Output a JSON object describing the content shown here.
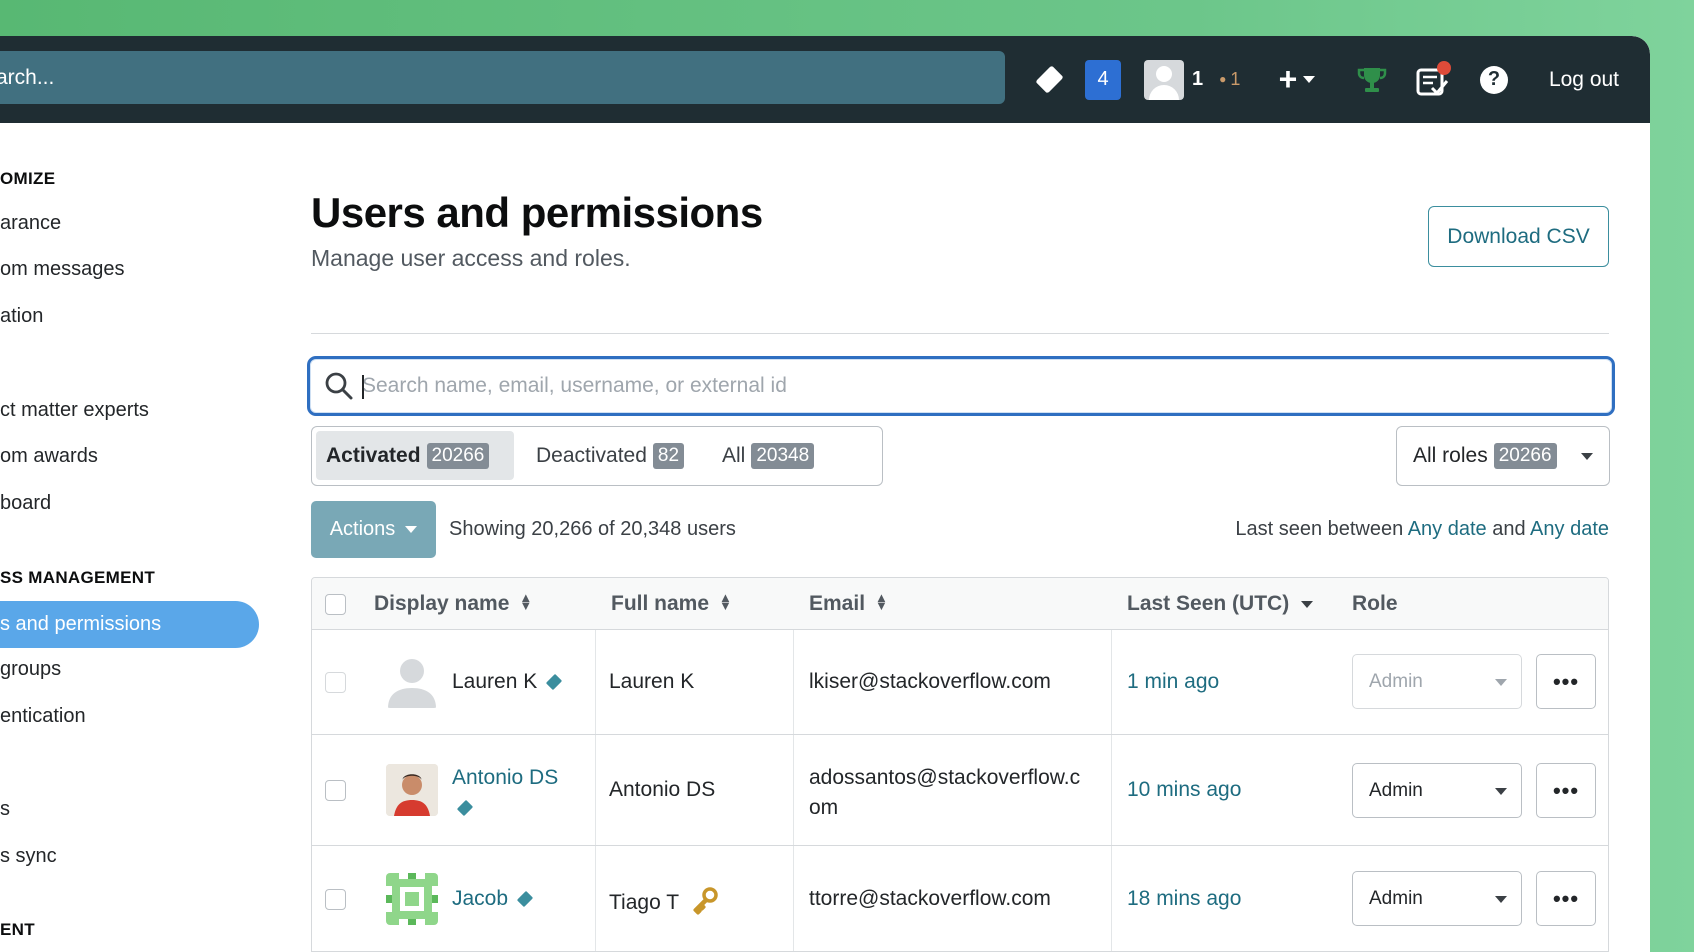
{
  "topbar": {
    "search_text": "arch...",
    "inbox_count": "4",
    "reputation": "1",
    "bronze_badges": "1",
    "logout_label": "Log out"
  },
  "sidebar": {
    "sections": [
      {
        "heading": "OMIZE",
        "items": [
          "arance",
          "om messages",
          "ation"
        ]
      },
      {
        "heading": "",
        "items": [
          "ct matter experts",
          "om awards",
          "board"
        ]
      },
      {
        "heading": "SS MANAGEMENT",
        "items": [
          "s and permissions",
          "groups",
          "entication"
        ]
      },
      {
        "heading": "",
        "items": [
          "s",
          "s sync"
        ]
      },
      {
        "heading": "ENT",
        "items": []
      }
    ]
  },
  "page": {
    "title": "Users and permissions",
    "subtitle": "Manage user access and roles.",
    "download_label": "Download CSV",
    "search_placeholder": "Search name, email, username, or external id",
    "filters": [
      {
        "label": "Activated",
        "count": "20266",
        "selected": true
      },
      {
        "label": "Deactivated",
        "count": "82"
      },
      {
        "label": "All",
        "count": "20348"
      }
    ],
    "roles_label": "All roles",
    "roles_count": "20266",
    "actions_label": "Actions",
    "showing_text": "Showing 20,266 of 20,348 users",
    "last_seen_prefix": "Last seen between",
    "any_date_1": "Any date",
    "and_text": "and",
    "any_date_2": "Any date"
  },
  "table": {
    "headers": {
      "display_name": "Display name",
      "full_name": "Full name",
      "email": "Email",
      "last_seen": "Last Seen (UTC)",
      "role": "Role"
    },
    "rows": [
      {
        "display_name": "Lauren K",
        "full_name": "Lauren K",
        "email": "lkiser@stackoverflow.com",
        "last_seen": "1 min ago",
        "role": "Admin"
      },
      {
        "display_name": "Antonio DS",
        "full_name": "Antonio DS",
        "email_line1": "adossantos@stackoverflow.c",
        "email_line2": "om",
        "last_seen": "10 mins ago",
        "role": "Admin"
      },
      {
        "display_name": "Jacob",
        "full_name": "Tiago T",
        "email": "ttorre@stackoverflow.com",
        "last_seen": "18 mins ago",
        "role": "Admin"
      }
    ],
    "more_label": "•••"
  },
  "colors": {
    "accent": "#1e6c80",
    "topbar": "#1f2d33",
    "active_nav": "#5aa7e9",
    "inbox": "#2d6fd3"
  }
}
